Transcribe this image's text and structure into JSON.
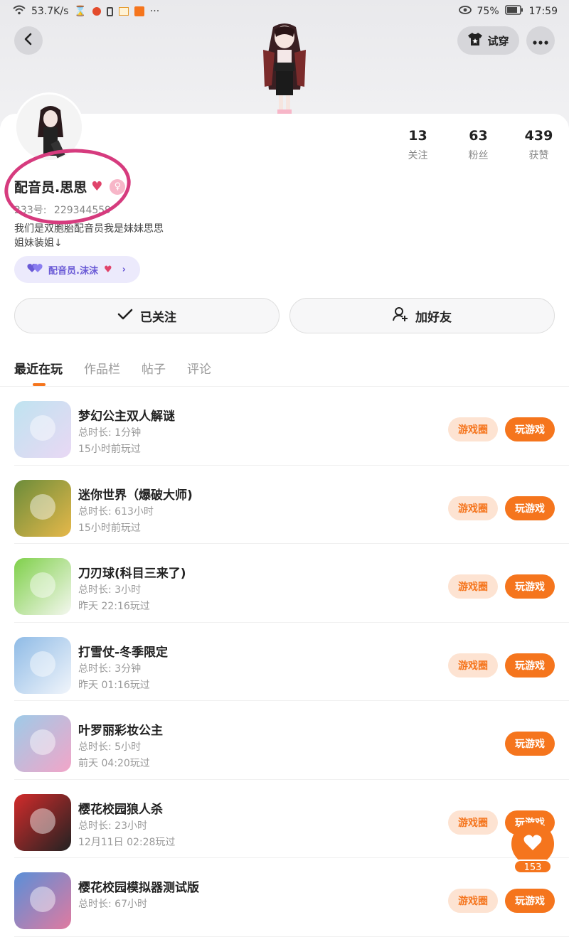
{
  "status_bar": {
    "speed": "53.7K/s",
    "battery": "75%",
    "time": "17:59"
  },
  "header": {
    "try_on": "试穿"
  },
  "profile": {
    "name": "配音员.思思",
    "uid_label": "233号:",
    "uid": "229344559",
    "bio_line1": "我们是双胞胎配音员我是妹妹思思",
    "bio_line2": "姐妹装姐↓",
    "relation_name": "配音员.沫沫"
  },
  "stats": [
    {
      "value": "13",
      "label": "关注"
    },
    {
      "value": "63",
      "label": "粉丝"
    },
    {
      "value": "439",
      "label": "获赞"
    }
  ],
  "actions": {
    "followed": "已关注",
    "add_friend": "加好友"
  },
  "tabs": [
    "最近在玩",
    "作品栏",
    "帖子",
    "评论"
  ],
  "buttons": {
    "circle": "游戏圈",
    "play": "玩游戏"
  },
  "games": [
    {
      "title": "梦幻公主双人解谜",
      "duration": "总时长:  1分钟",
      "last": "15小时前玩过",
      "has_circle": true,
      "colors": [
        "#bfe3f0",
        "#e9d8f4"
      ]
    },
    {
      "title": "迷你世界（爆破大师)",
      "duration": "总时长:  613小时",
      "last": "15小时前玩过",
      "has_circle": true,
      "colors": [
        "#6b8c3a",
        "#e6b84a"
      ]
    },
    {
      "title": "刀刃球(科目三来了)",
      "duration": "总时长:  3小时",
      "last": "昨天 22:16玩过",
      "has_circle": true,
      "colors": [
        "#7fd04a",
        "#f4f7ef"
      ]
    },
    {
      "title": "打雪仗-冬季限定",
      "duration": "总时长:  3分钟",
      "last": "昨天 01:16玩过",
      "has_circle": true,
      "colors": [
        "#8fbbe6",
        "#f1f5fb"
      ]
    },
    {
      "title": "叶罗丽彩妆公主",
      "duration": "总时长:  5小时",
      "last": "前天 04:20玩过",
      "has_circle": false,
      "colors": [
        "#9ecbe8",
        "#f2a5c8"
      ]
    },
    {
      "title": "樱花校园狼人杀",
      "duration": "总时长:  23小时",
      "last": "12月11日 02:28玩过",
      "has_circle": true,
      "colors": [
        "#d22b2b",
        "#222222"
      ]
    },
    {
      "title": "樱花校园模拟器测试版",
      "duration": "总时长:  67小时",
      "last": "",
      "has_circle": true,
      "colors": [
        "#5a8fd8",
        "#e07aa0"
      ]
    }
  ],
  "fab": {
    "count": "153"
  }
}
